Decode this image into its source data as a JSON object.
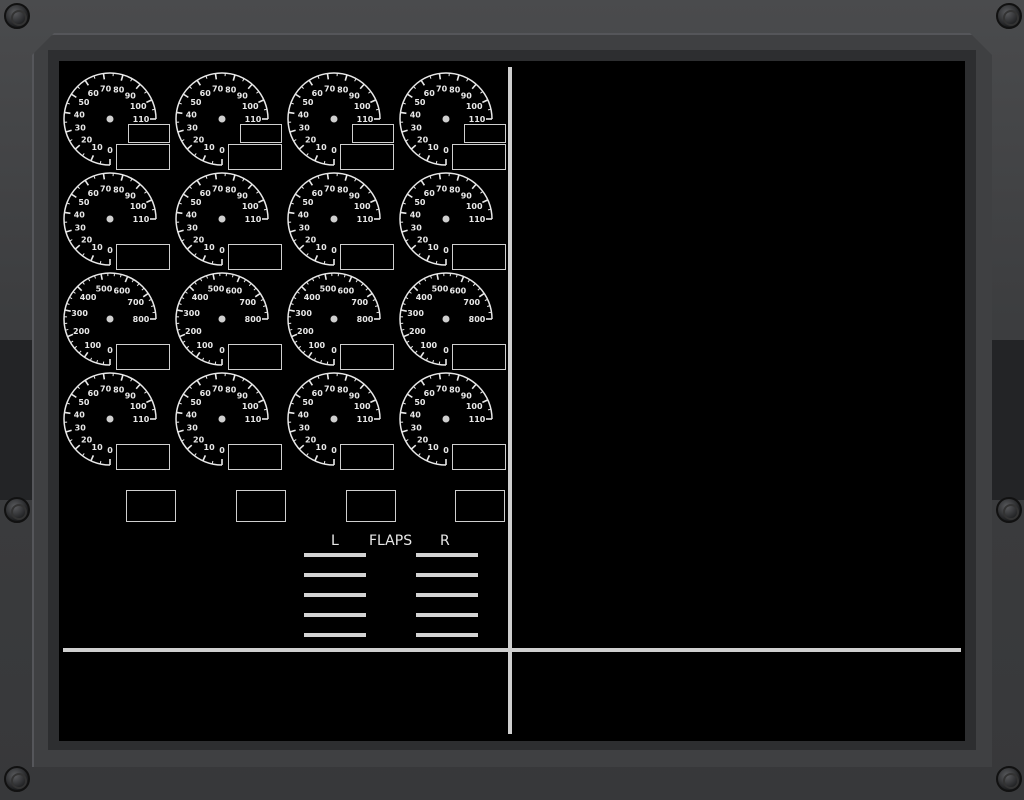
{
  "gauges": {
    "row_types": [
      "A",
      "A",
      "B",
      "A"
    ],
    "columns": 4,
    "scale_A": {
      "labels": [
        "0",
        "10",
        "20",
        "30",
        "40",
        "50",
        "60",
        "70",
        "80",
        "90",
        "100",
        "110"
      ],
      "needle_value": null
    },
    "scale_B": {
      "labels": [
        "0",
        "100",
        "200",
        "300",
        "400",
        "500",
        "600",
        "700",
        "800"
      ],
      "needle_value": null
    }
  },
  "bottom_boxes": {
    "count": 4
  },
  "flaps": {
    "title": "FLAPS",
    "left_label": "L",
    "right_label": "R",
    "bar_count": 5
  },
  "colors": {
    "screen_bg": "#000000",
    "marking": "#e8e8e8",
    "bar": "#d4d4d4",
    "bezel": "#3a3b3d"
  }
}
